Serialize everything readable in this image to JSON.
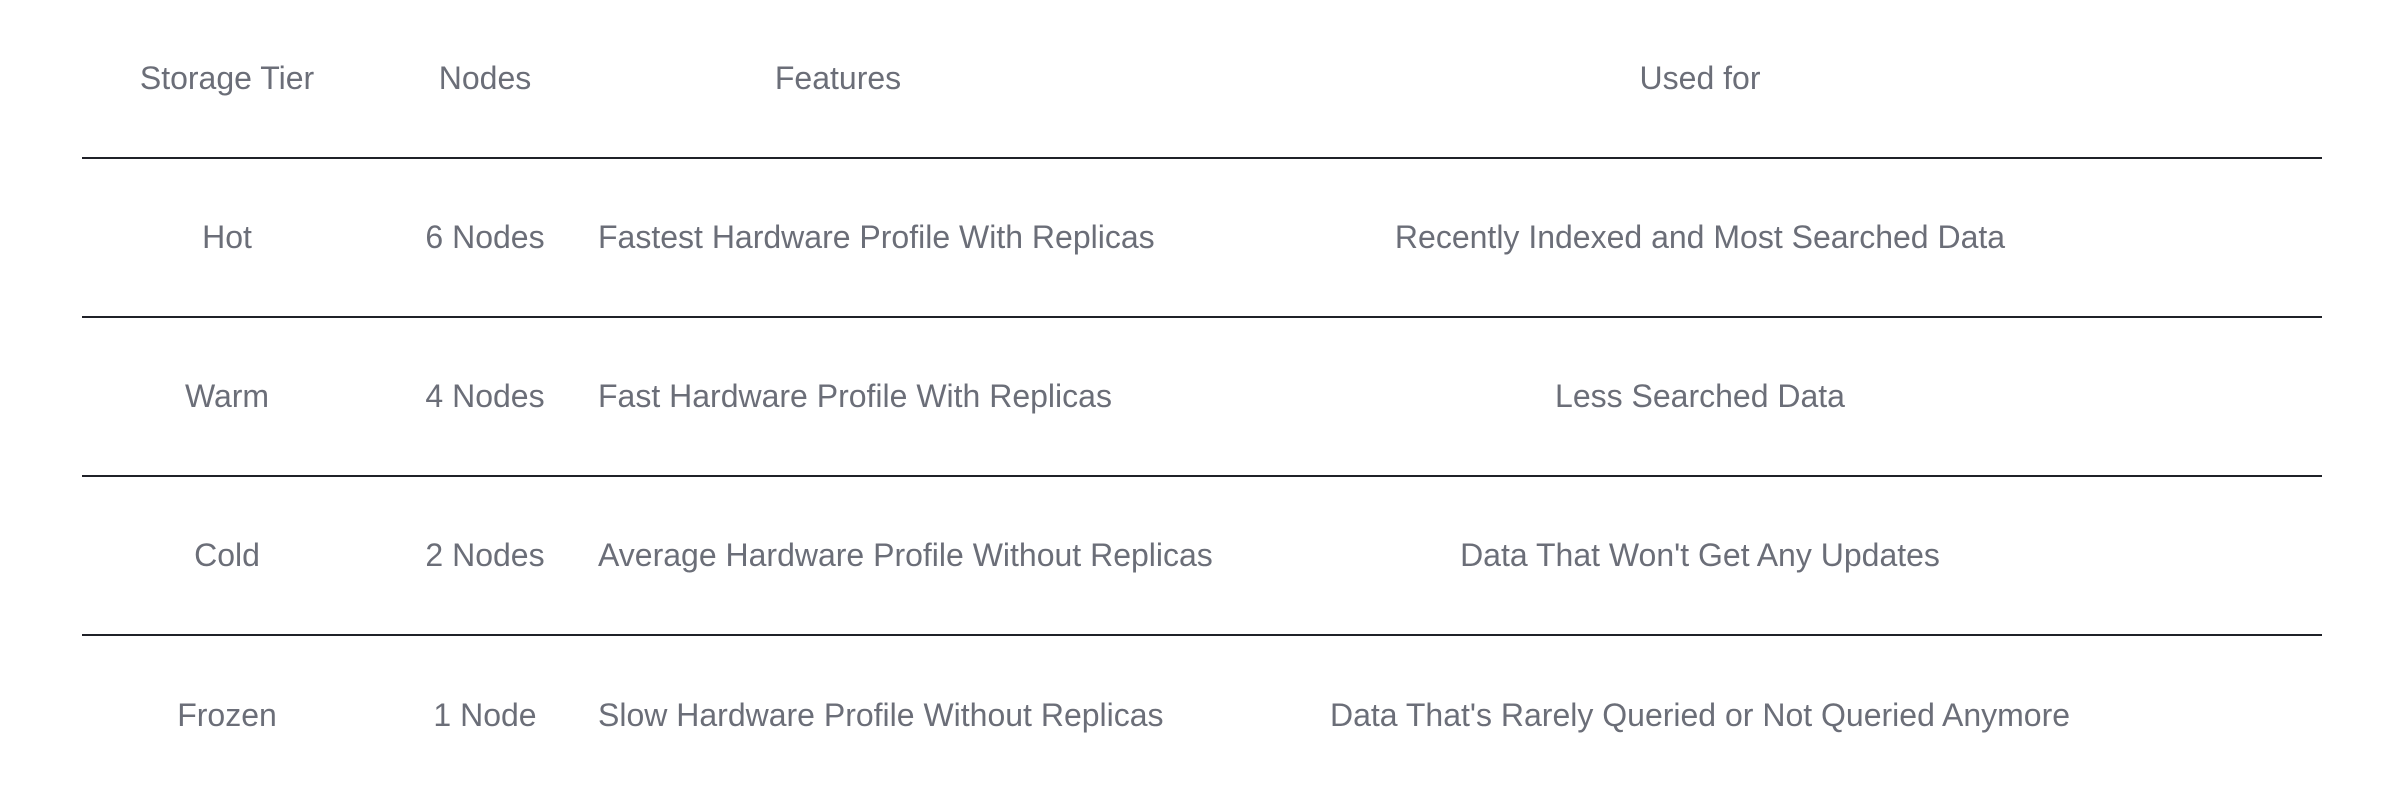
{
  "table": {
    "headers": {
      "tier": "Storage Tier",
      "nodes": "Nodes",
      "features": "Features",
      "used": "Used for"
    },
    "rows": [
      {
        "tier": "Hot",
        "nodes": "6 Nodes",
        "features": "Fastest Hardware Profile With Replicas",
        "used": "Recently Indexed and Most Searched Data"
      },
      {
        "tier": "Warm",
        "nodes": "4 Nodes",
        "features": "Fast Hardware Profile With Replicas",
        "used": "Less Searched Data"
      },
      {
        "tier": "Cold",
        "nodes": "2 Nodes",
        "features": "Average Hardware Profile Without Replicas",
        "used": "Data That Won't Get Any Updates"
      },
      {
        "tier": "Frozen",
        "nodes": "1 Node",
        "features": "Slow Hardware Profile Without Replicas",
        "used": "Data That's Rarely Queried or Not Queried Anymore"
      }
    ]
  }
}
